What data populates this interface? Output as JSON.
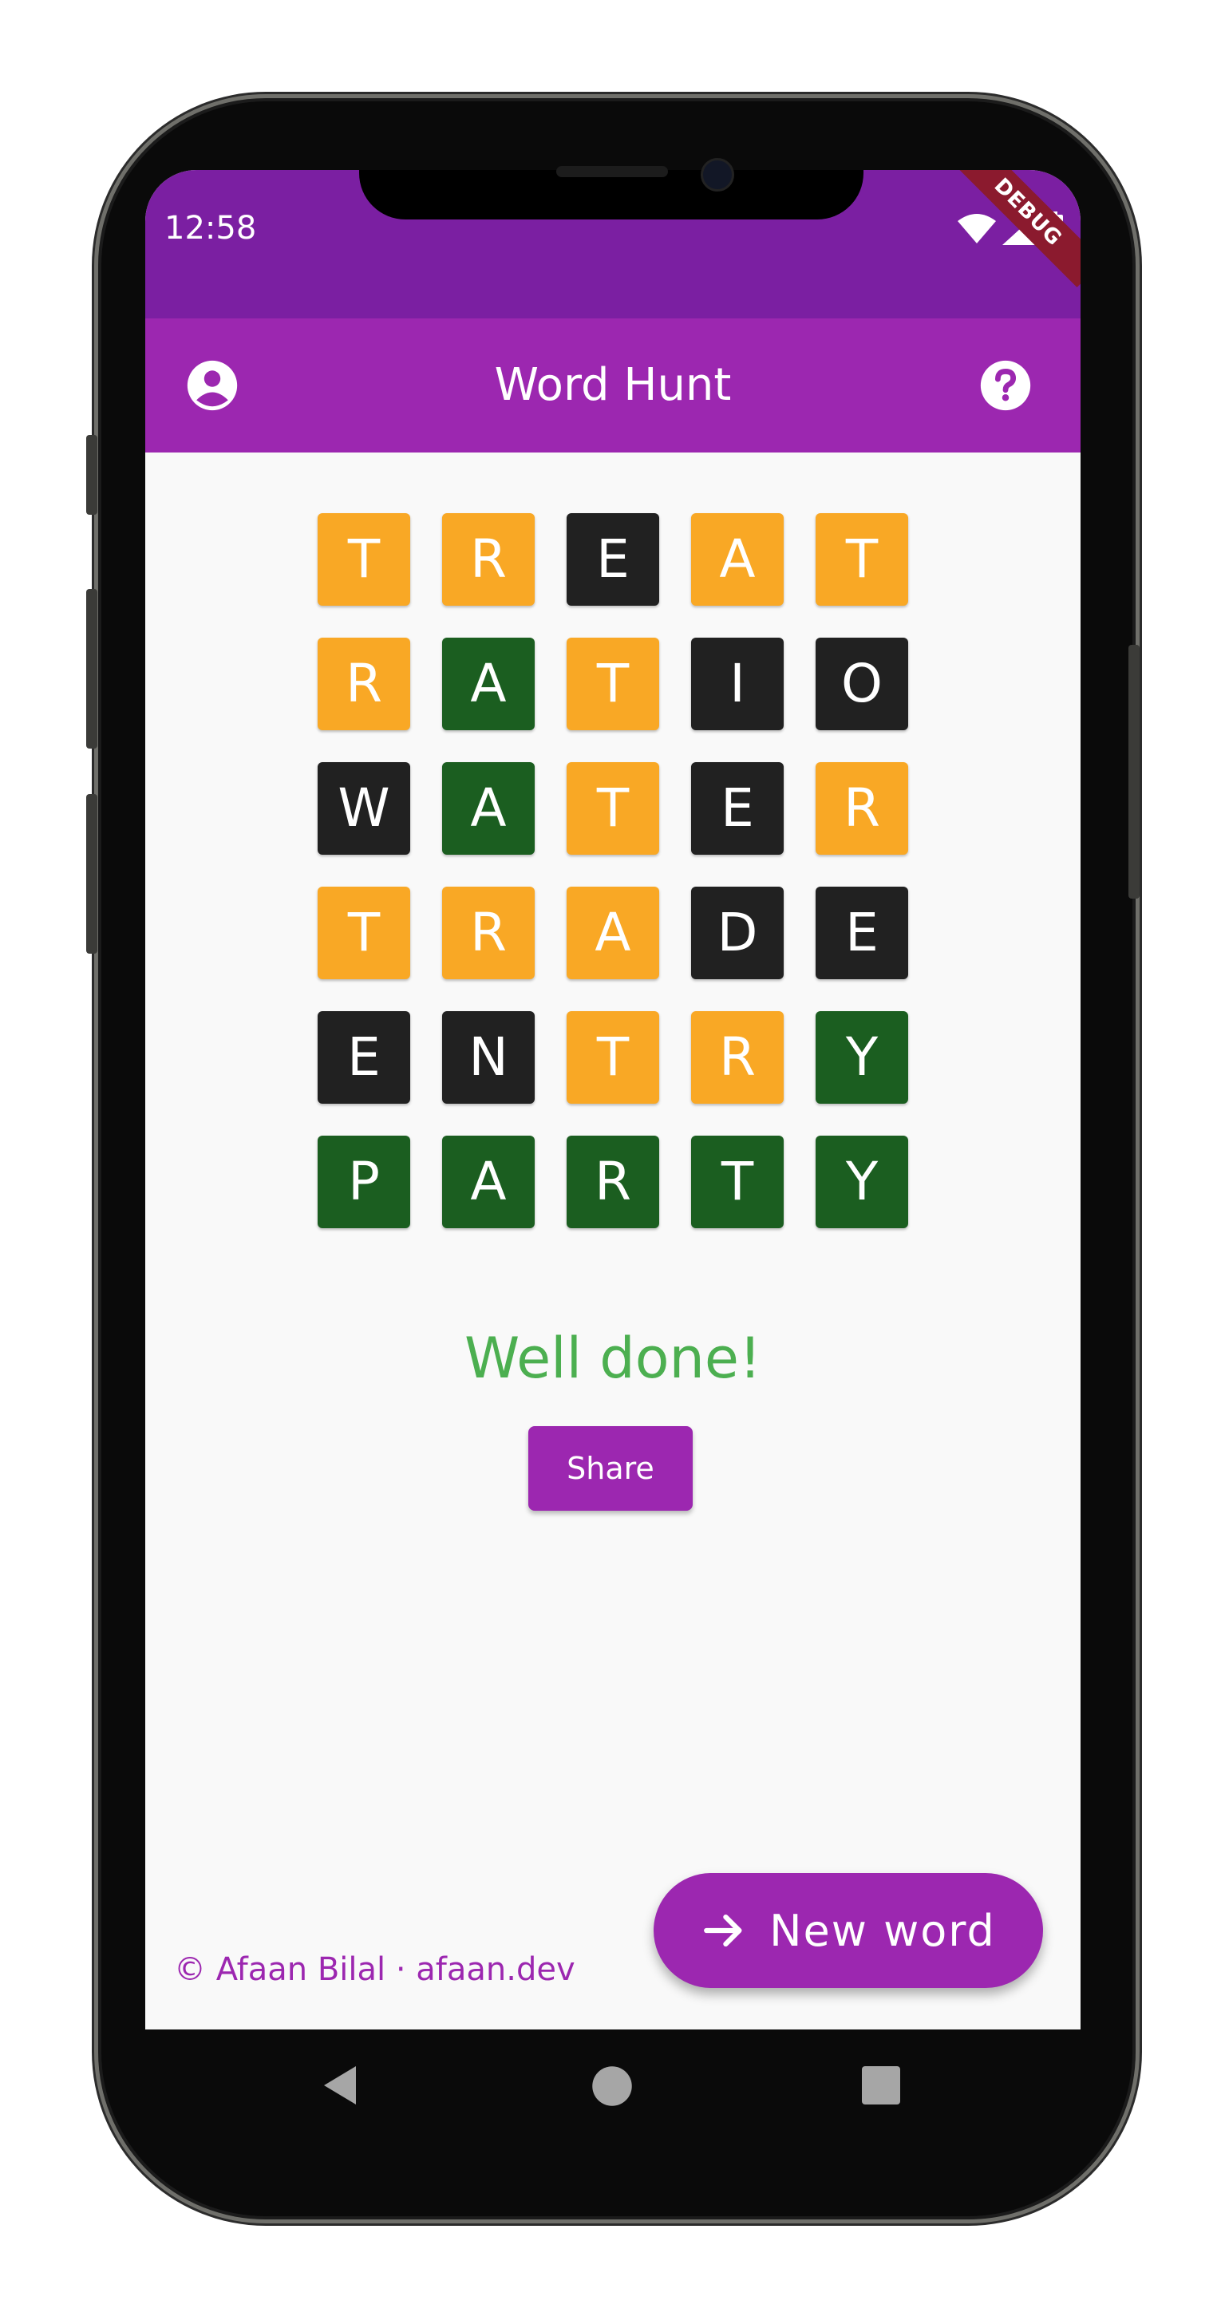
{
  "status_bar": {
    "time": "12:58",
    "debug_label": "DEBUG",
    "background_color": "#7b1fa2"
  },
  "app_bar": {
    "title": "Word Hunt",
    "background_color": "#9c27b0",
    "left_icon": "account-circle-icon",
    "right_icon": "help-icon"
  },
  "board": {
    "colors": {
      "orange": "#f9a825",
      "black": "#212121",
      "green": "#1b5e20"
    },
    "rows": [
      [
        {
          "letter": "T",
          "state": "orange"
        },
        {
          "letter": "R",
          "state": "orange"
        },
        {
          "letter": "E",
          "state": "black"
        },
        {
          "letter": "A",
          "state": "orange"
        },
        {
          "letter": "T",
          "state": "orange"
        }
      ],
      [
        {
          "letter": "R",
          "state": "orange"
        },
        {
          "letter": "A",
          "state": "green"
        },
        {
          "letter": "T",
          "state": "orange"
        },
        {
          "letter": "I",
          "state": "black"
        },
        {
          "letter": "O",
          "state": "black"
        }
      ],
      [
        {
          "letter": "W",
          "state": "black"
        },
        {
          "letter": "A",
          "state": "green"
        },
        {
          "letter": "T",
          "state": "orange"
        },
        {
          "letter": "E",
          "state": "black"
        },
        {
          "letter": "R",
          "state": "orange"
        }
      ],
      [
        {
          "letter": "T",
          "state": "orange"
        },
        {
          "letter": "R",
          "state": "orange"
        },
        {
          "letter": "A",
          "state": "orange"
        },
        {
          "letter": "D",
          "state": "black"
        },
        {
          "letter": "E",
          "state": "black"
        }
      ],
      [
        {
          "letter": "E",
          "state": "black"
        },
        {
          "letter": "N",
          "state": "black"
        },
        {
          "letter": "T",
          "state": "orange"
        },
        {
          "letter": "R",
          "state": "orange"
        },
        {
          "letter": "Y",
          "state": "green"
        }
      ],
      [
        {
          "letter": "P",
          "state": "green"
        },
        {
          "letter": "A",
          "state": "green"
        },
        {
          "letter": "R",
          "state": "green"
        },
        {
          "letter": "T",
          "state": "green"
        },
        {
          "letter": "Y",
          "state": "green"
        }
      ]
    ]
  },
  "result": {
    "message": "Well done!",
    "message_color": "#4caf50",
    "share_label": "Share"
  },
  "fab": {
    "label": "New word",
    "icon": "arrow-forward-icon"
  },
  "footer": {
    "copyright": "© Afaan Bilal · afaan.dev"
  },
  "nav_bar": {
    "back_icon": "back-triangle-icon",
    "home_icon": "home-circle-icon",
    "recents_icon": "recents-square-icon"
  }
}
